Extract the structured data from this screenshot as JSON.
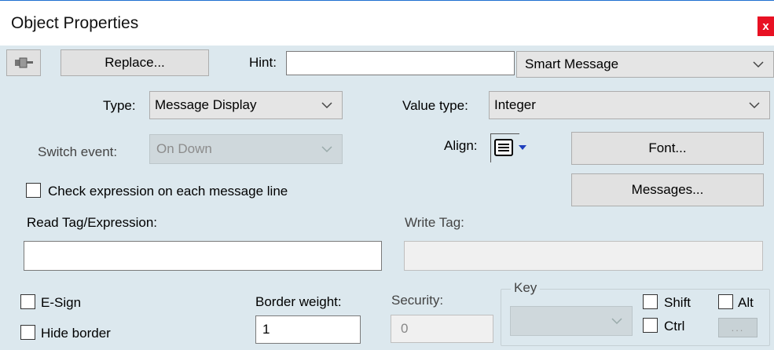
{
  "window": {
    "title": "Object Properties",
    "close_label": "x"
  },
  "toolbar": {
    "pin_icon": "pin-icon",
    "replace_label": "Replace...",
    "hint_label": "Hint:",
    "hint_value": "",
    "smart_select": "Smart Message"
  },
  "type": {
    "label": "Type:",
    "value": "Message Display"
  },
  "value_type": {
    "label": "Value type:",
    "value": "Integer"
  },
  "switch_event": {
    "label": "Switch event:",
    "value": "On Down"
  },
  "align": {
    "label": "Align:",
    "icon": "align-left-lines-icon"
  },
  "buttons": {
    "font": "Font...",
    "messages": "Messages..."
  },
  "check_expression": {
    "label": "Check expression on each message line",
    "checked": false
  },
  "read_tag": {
    "label": "Read Tag/Expression:",
    "value": ""
  },
  "write_tag": {
    "label": "Write Tag:",
    "value": ""
  },
  "esign": {
    "label": "E-Sign",
    "checked": false
  },
  "hide_border": {
    "label": "Hide border",
    "checked": false
  },
  "border_weight": {
    "label": "Border weight:",
    "value": "1"
  },
  "security": {
    "label": "Security:",
    "value": "0"
  },
  "key": {
    "group_label": "Key",
    "select_value": "",
    "shift_label": "Shift",
    "ctrl_label": "Ctrl",
    "alt_label": "Alt",
    "ellipsis_label": "..."
  },
  "colors": {
    "panel": "#dce8ee",
    "close": "#e81123",
    "align_arrow": "#1e3fbd"
  }
}
